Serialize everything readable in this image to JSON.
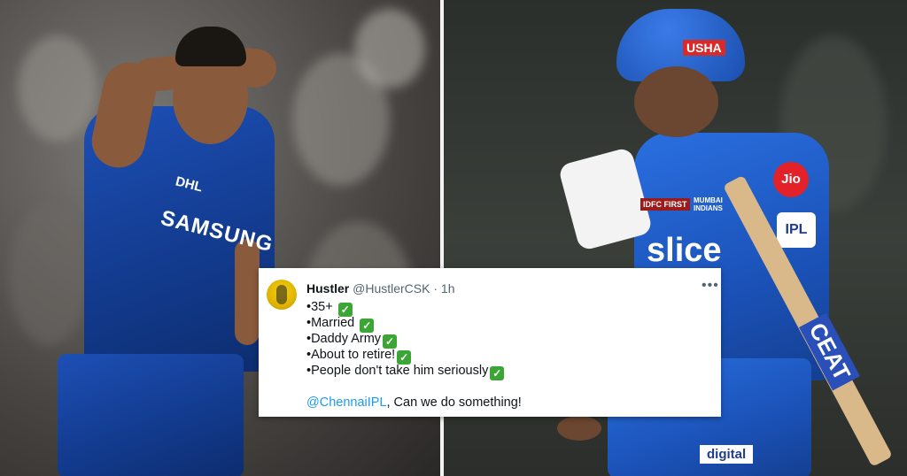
{
  "tweet": {
    "name": "Hustler",
    "handle": "@HustlerCSK",
    "separator": "·",
    "time": "1h",
    "more_icon": "more-horizontal-icon",
    "lines": [
      "•35+",
      "•Married",
      "•Daddy Army",
      "•About to retire!",
      "•People don't take him seriously"
    ],
    "check_icon": "white-check-mark-icon",
    "check_color": "#3ba635",
    "mention": "@ChennaiIPL",
    "reply_text": ", Can we do something!",
    "mention_color": "#1d9bf0"
  },
  "photos": {
    "left": {
      "sponsor_main": "SAMSUNG",
      "sponsor_small": "DHL"
    },
    "right": {
      "helmet_sponsor": "USHA",
      "chest_sponsor": "slice",
      "badge_jio": "Jio",
      "badge_ipl": "IPL",
      "team": "MUMBAI INDIANS",
      "lower_sponsor": "digital",
      "bat_text": "CEAT",
      "idfc": "IDFC FIRST"
    }
  }
}
